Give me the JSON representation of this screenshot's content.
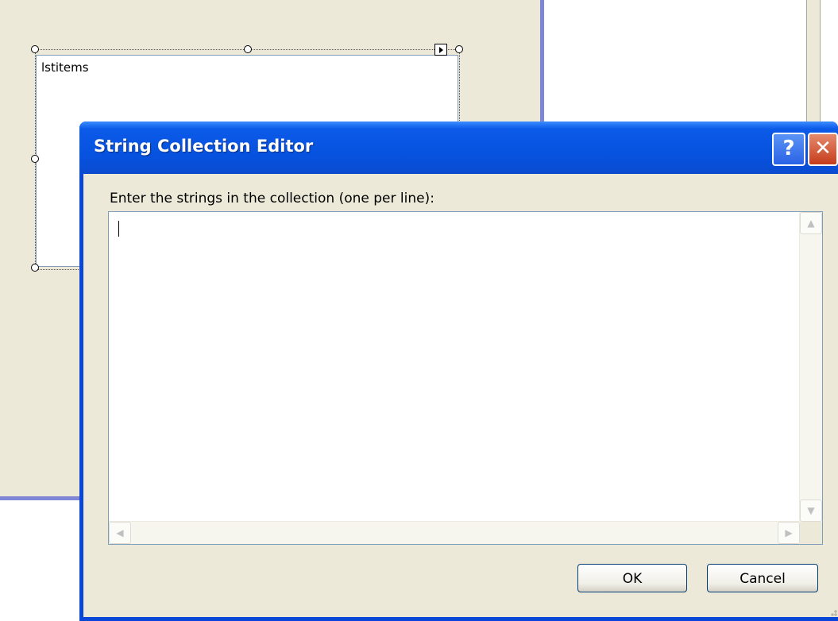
{
  "designer": {
    "listbox_name": "lstitems"
  },
  "dialog": {
    "title": "String Collection Editor",
    "prompt": "Enter the strings in the collection (one per line):",
    "text_value": "",
    "ok_label": "OK",
    "cancel_label": "Cancel",
    "help_glyph": "?",
    "close_glyph": "✕"
  },
  "icons": {
    "help": "help-icon",
    "close": "close-icon",
    "scroll_up": "chevron-up-icon",
    "scroll_down": "chevron-down-icon",
    "scroll_left": "chevron-left-icon",
    "scroll_right": "chevron-right-icon",
    "smart_tag": "smart-tag-arrow-icon"
  },
  "colors": {
    "titlebar": "#0653e0",
    "dialog_face": "#ece9d8",
    "close_button": "#c63c1b",
    "designer_border": "#7f86d6"
  }
}
